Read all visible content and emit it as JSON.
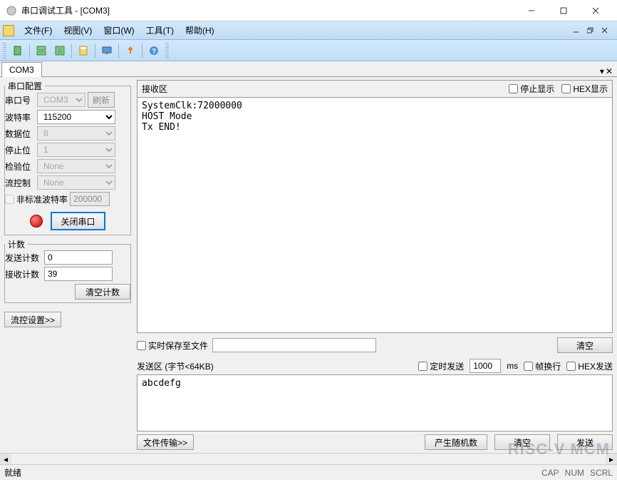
{
  "window": {
    "title": "串口调试工具 - [COM3]"
  },
  "menu": {
    "file": "文件(F)",
    "view": "视图(V)",
    "window": "窗口(W)",
    "tools": "工具(T)",
    "help": "帮助(H)"
  },
  "tab": {
    "label": "COM3"
  },
  "config": {
    "legend": "串口配置",
    "port_label": "串口号",
    "port_value": "COM3",
    "refresh": "刷新",
    "baud_label": "波特率",
    "baud_value": "115200",
    "databits_label": "数据位",
    "databits_value": "8",
    "stopbits_label": "停止位",
    "stopbits_value": "1",
    "parity_label": "检验位",
    "parity_value": "None",
    "flow_label": "流控制",
    "flow_value": "None",
    "nonstd_label": "非标准波特率",
    "nonstd_value": "200000",
    "close_btn": "关闭串口"
  },
  "count": {
    "legend": "计数",
    "send_label": "发送计数",
    "send_value": "0",
    "recv_label": "接收计数",
    "recv_value": "39",
    "clear_btn": "清空计数"
  },
  "flowctrl_btn": "流控设置>>",
  "recv": {
    "title": "接收区",
    "pause_label": "停止显示",
    "hex_label": "HEX显示",
    "content": "SystemClk:72000000\nHOST Mode\nTx END!",
    "save_label": "实时保存至文件",
    "clear_btn": "清空"
  },
  "send": {
    "title": "发送区 (字节<64KB)",
    "timed_label": "定时发送",
    "timed_value": "1000",
    "timed_unit": "ms",
    "wrap_label": "帧换行",
    "hex_label": "HEX发送",
    "content": "abcdefg",
    "file_btn": "文件传输>>",
    "random_btn": "产生随机数",
    "clear_btn": "清空",
    "send_btn": "发送"
  },
  "status": {
    "ready": "就绪",
    "cap": "CAP",
    "num": "NUM",
    "scrl": "SCRL"
  },
  "watermark": "RISC-V MCM"
}
